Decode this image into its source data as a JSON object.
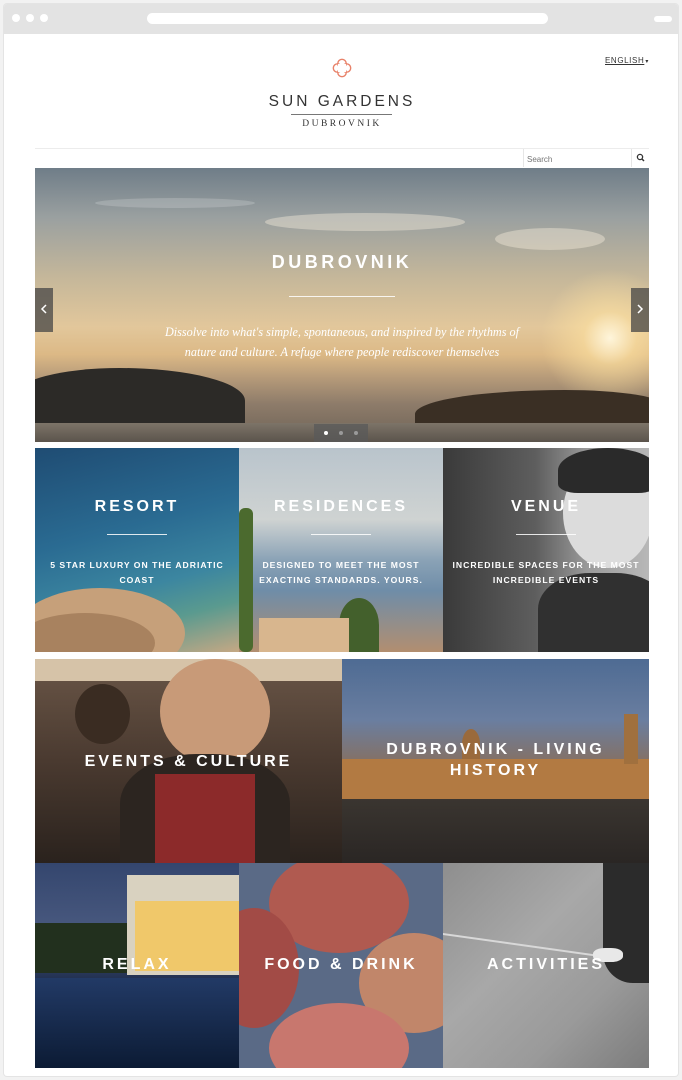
{
  "brand": {
    "name": "SUN GARDENS",
    "location": "DUBROVNIK"
  },
  "header": {
    "language": "ENGLISH",
    "search_placeholder": "Search"
  },
  "hero": {
    "title": "DUBROVNIK",
    "text": "Dissolve into what's simple, spontaneous, and inspired by the rhythms of nature and culture. A refuge where people rediscover themselves",
    "slides_total": 3,
    "active_slide": 1
  },
  "tiles": [
    {
      "title": "RESORT",
      "subtitle": "5 STAR LUXURY ON THE ADRIATIC COAST"
    },
    {
      "title": "RESIDENCES",
      "subtitle": "DESIGNED TO MEET THE MOST EXACTING STANDARDS. YOURS."
    },
    {
      "title": "VENUE",
      "subtitle": "INCREDIBLE SPACES FOR THE MOST INCREDIBLE EVENTS"
    },
    {
      "title": "EVENTS & CULTURE"
    },
    {
      "title": "DUBROVNIK - LIVING HISTORY"
    },
    {
      "title": "RELAX"
    },
    {
      "title": "FOOD & DRINK"
    },
    {
      "title": "ACTIVITIES"
    }
  ],
  "icons": [
    "logo-icon",
    "chevron-down-icon",
    "search-icon",
    "arrow-left-icon",
    "arrow-right-icon"
  ],
  "colors": {
    "accent": "#e8826a",
    "text": "#333333"
  }
}
